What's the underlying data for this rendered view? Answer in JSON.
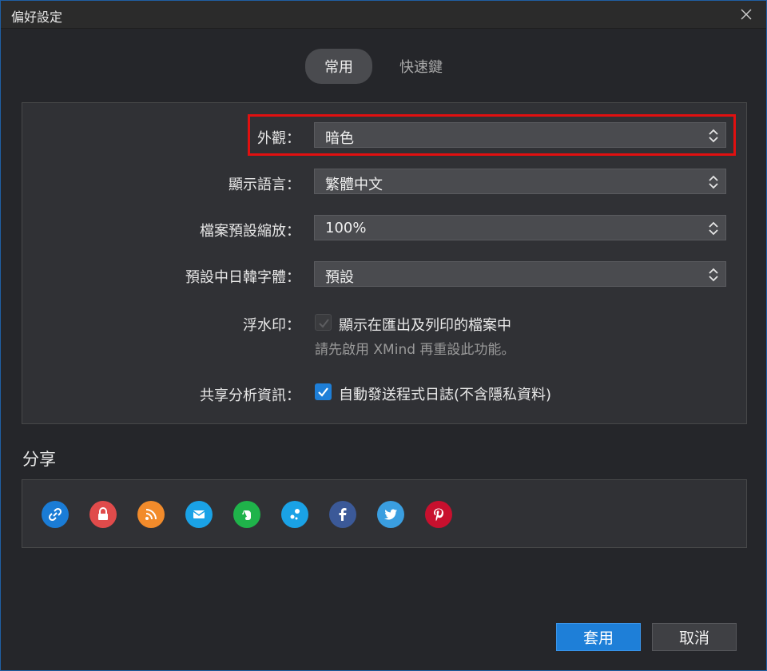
{
  "window": {
    "title": "偏好設定"
  },
  "tabs": [
    {
      "label": "常用",
      "active": true
    },
    {
      "label": "快速鍵",
      "active": false
    }
  ],
  "settings": {
    "appearance": {
      "label": "外觀：",
      "value": "暗色"
    },
    "language": {
      "label": "顯示語言：",
      "value": "繁體中文"
    },
    "zoom": {
      "label": "檔案預設縮放：",
      "value": "100%"
    },
    "cjk_font": {
      "label": "預設中日韓字體：",
      "value": "預設"
    },
    "watermark": {
      "label": "浮水印：",
      "checkbox_label": "顯示在匯出及列印的檔案中",
      "checked": true,
      "disabled": true,
      "note": "請先啟用 XMind 再重設此功能。"
    },
    "analytics": {
      "label": "共享分析資訊：",
      "checkbox_label": "自動發送程式日誌(不含隱私資料)",
      "checked": true
    }
  },
  "share": {
    "title": "分享",
    "icons": [
      {
        "name": "link-icon",
        "color": "#1a7cd6"
      },
      {
        "name": "lock-icon",
        "color": "#e04b4b"
      },
      {
        "name": "rss-icon",
        "color": "#f28b2b"
      },
      {
        "name": "mail-icon",
        "color": "#1aa2e6"
      },
      {
        "name": "evernote-icon",
        "color": "#1fb34a"
      },
      {
        "name": "dots-icon",
        "color": "#1aa2e6"
      },
      {
        "name": "facebook-icon",
        "color": "#3b5998"
      },
      {
        "name": "twitter-icon",
        "color": "#3a9ee0"
      },
      {
        "name": "pinterest-icon",
        "color": "#c8102e"
      }
    ]
  },
  "buttons": {
    "apply": "套用",
    "cancel": "取消"
  },
  "colors": {
    "accent": "#1e7fd8",
    "highlight": "#e11010"
  }
}
